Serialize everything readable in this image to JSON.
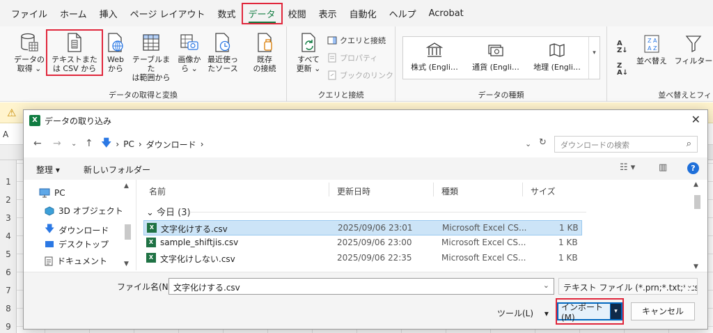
{
  "ribbon_tabs": [
    "ファイル",
    "ホーム",
    "挿入",
    "ページ レイアウト",
    "数式",
    "データ",
    "校閲",
    "表示",
    "自動化",
    "ヘルプ",
    "Acrobat"
  ],
  "active_tab": "データ",
  "ribbon": {
    "get_data": {
      "buttons": [
        {
          "label": "データの\n取得 ⌄",
          "icon": "database-icon"
        },
        {
          "label": "テキストまた\nは CSV から",
          "icon": "text-file-icon"
        },
        {
          "label": "Web\nから",
          "icon": "web-icon"
        },
        {
          "label": "テーブルまた\nは範囲から",
          "icon": "table-icon"
        },
        {
          "label": "画像か\nら ⌄",
          "icon": "image-icon"
        },
        {
          "label": "最近使っ\nたソース",
          "icon": "recent-sources-icon"
        },
        {
          "label": "既存\nの接続",
          "icon": "existing-connections-icon"
        }
      ],
      "group_label": "データの取得と変換"
    },
    "queries": {
      "refresh_all": "すべて\n更新 ⌄",
      "queries_connections": "クエリと接続",
      "properties": "プロパティ",
      "edit_links": "ブックのリンク",
      "group_label": "クエリと接続"
    },
    "data_types": {
      "items": [
        "株式 (Engli…",
        "通貨 (Engli…",
        "地理 (Engli…"
      ],
      "group_label": "データの種類"
    },
    "sort_filter": {
      "sort_label": "並べ替え",
      "filter_label": "フィルター",
      "group_label": "並べ替えとフィ"
    }
  },
  "sheet": {
    "namebox": "A",
    "rows": [
      "1",
      "2",
      "3",
      "4",
      "5",
      "6",
      "7",
      "8",
      "9"
    ]
  },
  "dialog": {
    "title": "データの取り込み",
    "address": {
      "segments": [
        "PC",
        "ダウンロード"
      ],
      "search_placeholder": "ダウンロードの検索"
    },
    "commands": {
      "organize": "整理 ▾",
      "new_folder": "新しいフォルダー"
    },
    "nav": [
      {
        "label": "PC",
        "icon": "pc-icon"
      },
      {
        "label": "3D オブジェクト",
        "icon": "3d-objects-icon"
      },
      {
        "label": "ダウンロード",
        "icon": "download-icon"
      },
      {
        "label": "デスクトップ",
        "icon": "desktop-icon"
      },
      {
        "label": "ドキュメント",
        "icon": "documents-icon"
      }
    ],
    "columns": [
      "名前",
      "更新日時",
      "種類",
      "サイズ"
    ],
    "group": "今日 (3)",
    "files": [
      {
        "name": "文字化けする.csv",
        "modified": "2025/09/06 23:01",
        "type": "Microsoft Excel CS...",
        "size": "1 KB",
        "selected": true
      },
      {
        "name": "sample_shiftjis.csv",
        "modified": "2025/09/06 23:00",
        "type": "Microsoft Excel CS...",
        "size": "1 KB",
        "selected": false
      },
      {
        "name": "文字化けしない.csv",
        "modified": "2025/09/06 22:35",
        "type": "Microsoft Excel CS...",
        "size": "1 KB",
        "selected": false
      }
    ],
    "filename_label": "ファイル名(N):",
    "filename_value": "文字化けする.csv",
    "filter": "テキスト ファイル (*.prn;*.txt;*.csv)",
    "tools": "ツール(L)",
    "import": "インポート(M)",
    "cancel": "キャンセル"
  },
  "colors": {
    "excel_green": "#107c41",
    "highlight_red": "#e0263b",
    "selection_blue": "#cce4f7",
    "button_blue": "#0067c0"
  }
}
